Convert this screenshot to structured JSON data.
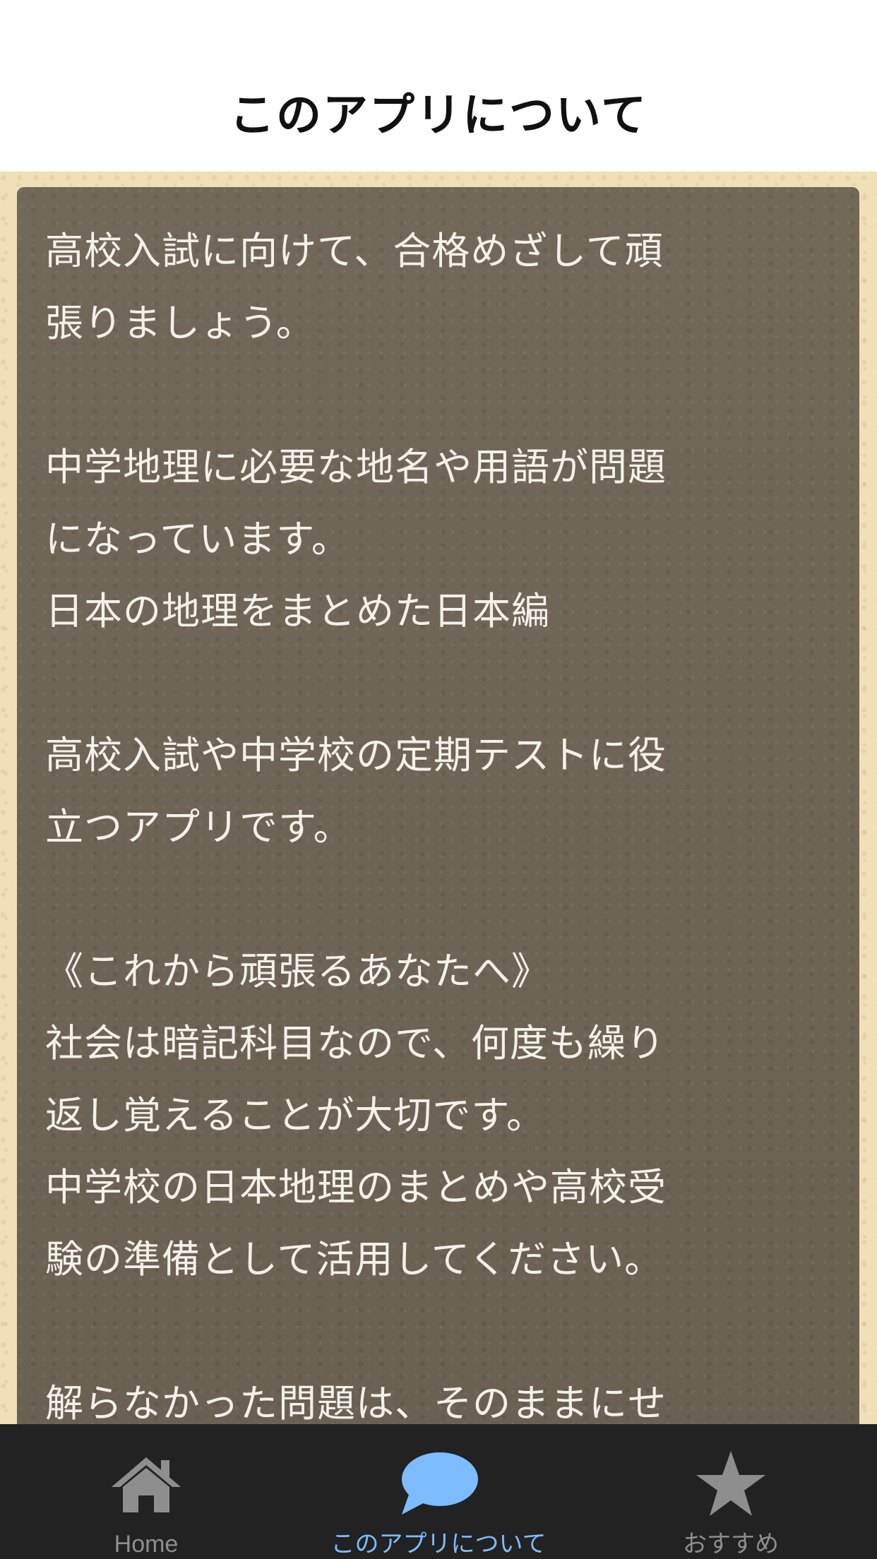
{
  "header": {
    "title": "このアプリについて"
  },
  "content": {
    "text": "高校入試に向けて、合格めざして頑\n張りましょう。\n\n中学地理に必要な地名や用語が問題\nになっています。\n日本の地理をまとめた日本編\n\n高校入試や中学校の定期テストに役\n立つアプリです。\n\n《これから頑張るあなたへ》\n社会は暗記科目なので、何度も繰り\n返し覚えることが大切です。\n中学校の日本地理のまとめや高校受\n験の準備として活用してください。\n\n解らなかった問題は、そのままにせ"
  },
  "tabbar": {
    "tabs": [
      {
        "label": "Home",
        "icon": "home-icon",
        "active": false
      },
      {
        "label": "このアプリについて",
        "icon": "speech-bubble-icon",
        "active": true
      },
      {
        "label": "おすすめ",
        "icon": "star-icon",
        "active": false
      }
    ],
    "colors": {
      "background": "#222222",
      "active": "#7cbcff",
      "inactive": "#8e8e8e"
    }
  },
  "colors": {
    "card_background": "#6f6556",
    "paper_background": "#f1dfb8",
    "card_text": "#f4f1ea"
  }
}
